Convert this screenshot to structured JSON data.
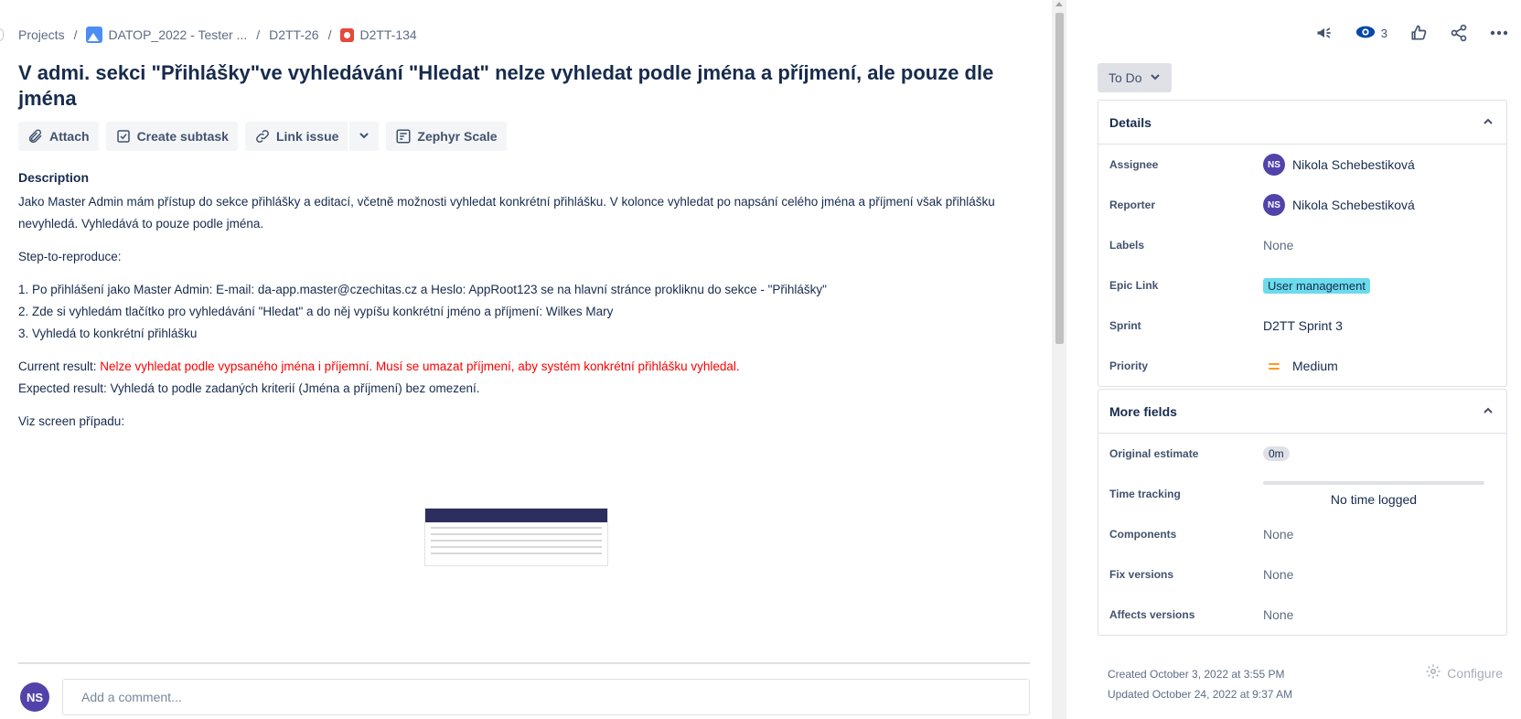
{
  "breadcrumb": {
    "projects": "Projects",
    "project": "DATOP_2022 - Tester ...",
    "parent": "D2TT-26",
    "issue": "D2TT-134"
  },
  "issue": {
    "title": "V admi. sekci \"Přihlášky\"ve vyhledávání \"Hledat\" nelze vyhledat podle jména a příjmení, ale pouze dle jména"
  },
  "actions": {
    "attach": "Attach",
    "create_subtask": "Create subtask",
    "link_issue": "Link issue",
    "zephyr": "Zephyr Scale"
  },
  "description": {
    "heading": "Description",
    "intro": "Jako Master Admin mám přístup do sekce přihlášky a editací, včetně možnosti vyhledat konkrétní přihlášku. V kolonce vyhledat po napsání celého jména a příjmení však přihlášku nevyhledá. Vyhledává to pouze podle jména.",
    "steps_heading": "Step-to-reproduce:",
    "step1": "1. Po přihlášení jako Master Admin: E-mail: da-app.master@czechitas.cz a Heslo: AppRoot123 se na hlavní stránce prokliknu do sekce - \"Přihlášky\"",
    "step2": "2. Zde si vyhledám tlačítko pro vyhledávání \"Hledat\" a do něj vypíšu konkrétní jméno a příjmení: Wilkes Mary",
    "step3": "3. Vyhledá to konkrétní přihlášku",
    "current_label": "Current result: ",
    "current_value": "Nelze vyhledat podle vypsaného jména i příjemní. Musí se umazat příjmení, aby systém konkrétní přihlášku vyhledal.",
    "expected": "Expected result: Vyhledá to podle zadaných kriterií (Jména a příjmení) bez omezení.",
    "screen": "Viz screen případu:"
  },
  "comment": {
    "avatar_initials": "NS",
    "placeholder": "Add a comment..."
  },
  "toolbar": {
    "watchers_count": "3"
  },
  "status": {
    "label": "To Do"
  },
  "details": {
    "heading": "Details",
    "assignee_label": "Assignee",
    "assignee_initials": "NS",
    "assignee": "Nikola Schebestiková",
    "reporter_label": "Reporter",
    "reporter_initials": "NS",
    "reporter": "Nikola Schebestiková",
    "labels_label": "Labels",
    "labels": "None",
    "epic_label": "Epic Link",
    "epic": "User management",
    "sprint_label": "Sprint",
    "sprint": "D2TT Sprint 3",
    "priority_label": "Priority",
    "priority": "Medium"
  },
  "more_fields": {
    "heading": "More fields",
    "original_estimate_label": "Original estimate",
    "original_estimate": "0m",
    "time_tracking_label": "Time tracking",
    "time_tracking": "No time logged",
    "components_label": "Components",
    "components": "None",
    "fix_versions_label": "Fix versions",
    "fix_versions": "None",
    "affects_versions_label": "Affects versions",
    "affects_versions": "None"
  },
  "meta": {
    "created": "Created October 3, 2022 at 3:55 PM",
    "updated": "Updated October 24, 2022 at 9:37 AM",
    "configure": "Configure"
  },
  "colors": {
    "accent": "#0052cc",
    "avatar": "#5243aa",
    "epic": "#6cdbec",
    "priority_medium": "#ff991f",
    "bug": "#e5493a",
    "current_result": "#ff0000"
  },
  "icons": [
    "attach-icon",
    "subtask-icon",
    "link-icon",
    "chevron-down-icon",
    "zephyr-icon",
    "announcement-icon",
    "eye-icon",
    "thumbs-up-icon",
    "share-icon",
    "more-icon",
    "chevron-up-icon",
    "gear-icon"
  ]
}
